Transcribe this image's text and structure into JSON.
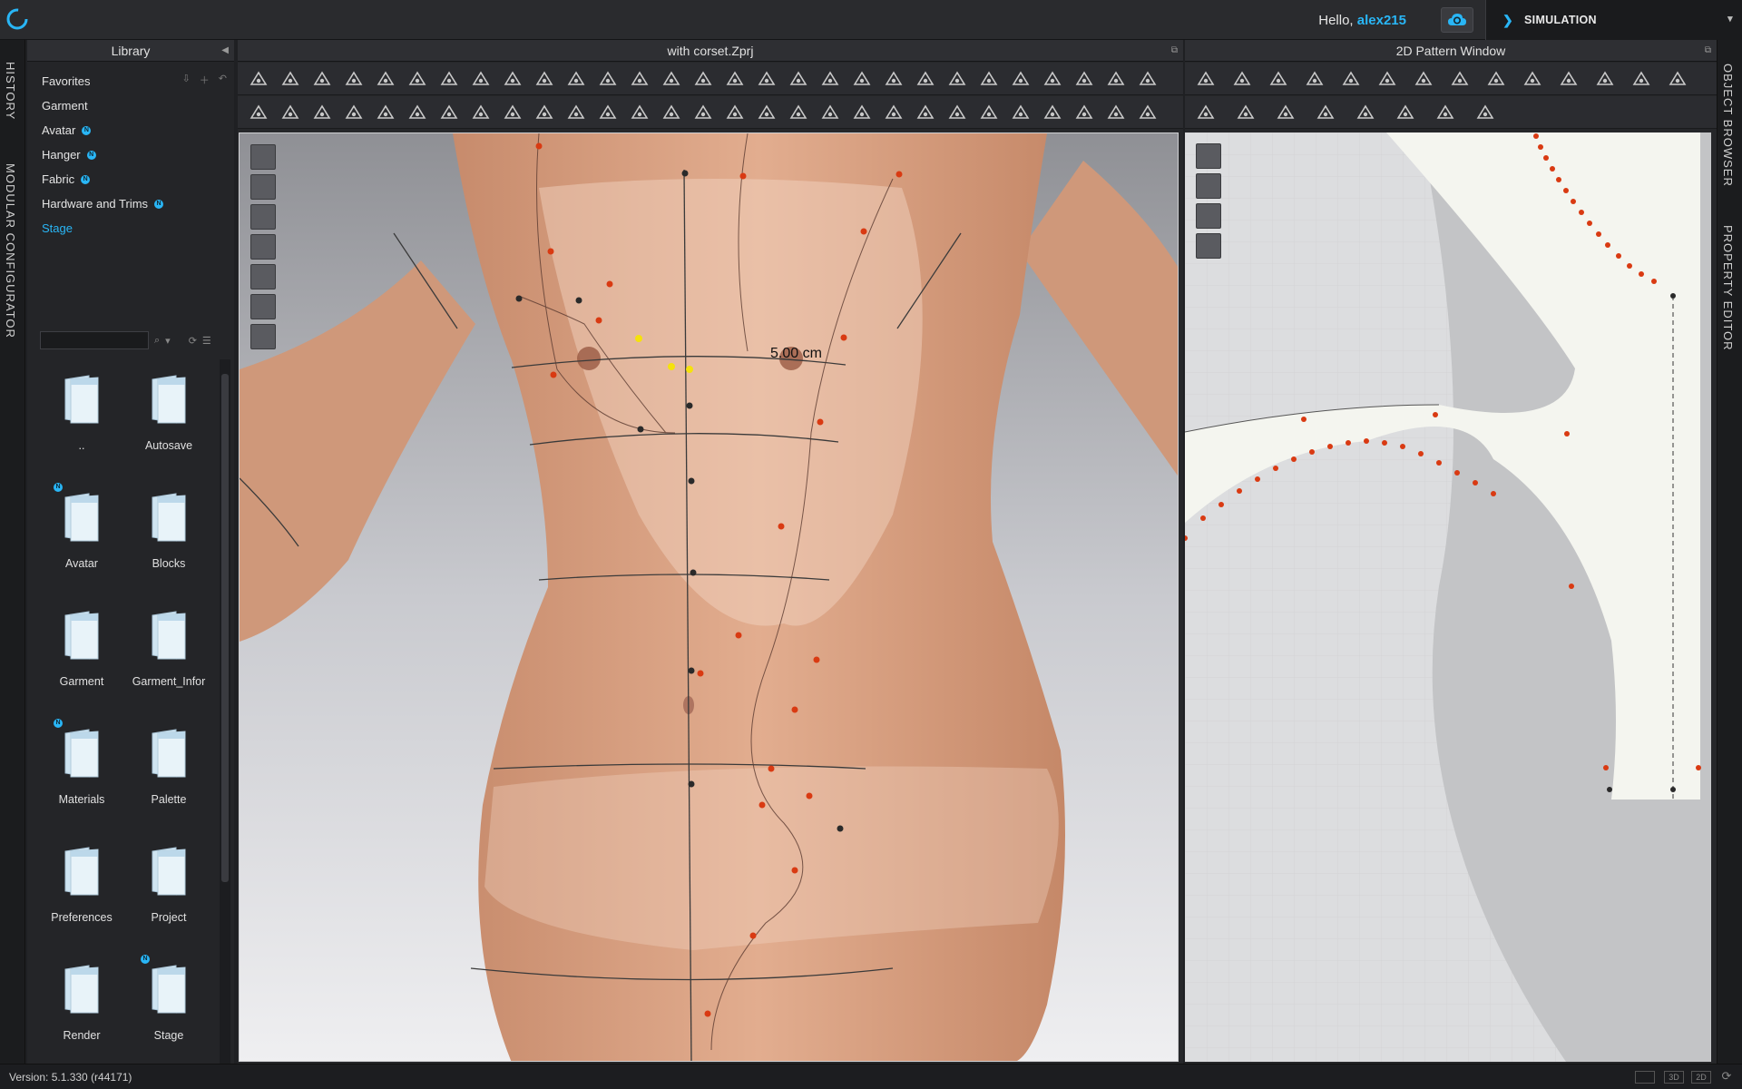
{
  "header": {
    "greeting": "Hello, ",
    "username": "alex215",
    "mode_label": "SIMULATION",
    "accent": "#29b6f6"
  },
  "left_tabs": [
    "HISTORY",
    "MODULAR CONFIGURATOR"
  ],
  "right_tabs": [
    "OBJECT BROWSER",
    "PROPERTY EDITOR"
  ],
  "library": {
    "title": "Library",
    "items": [
      {
        "label": "Favorites",
        "badge": false
      },
      {
        "label": "Garment",
        "badge": false
      },
      {
        "label": "Avatar",
        "badge": true
      },
      {
        "label": "Hanger",
        "badge": true
      },
      {
        "label": "Fabric",
        "badge": true
      },
      {
        "label": "Hardware and Trims",
        "badge": true
      },
      {
        "label": "Stage",
        "badge": false,
        "active": true
      }
    ],
    "search_value": "",
    "folders": [
      {
        "label": "..",
        "badge": false
      },
      {
        "label": "Autosave",
        "badge": false
      },
      {
        "label": "Avatar",
        "badge": true
      },
      {
        "label": "Blocks",
        "badge": false
      },
      {
        "label": "Garment",
        "badge": false
      },
      {
        "label": "Garment_Infor",
        "badge": false
      },
      {
        "label": "Materials",
        "badge": true
      },
      {
        "label": "Palette",
        "badge": false
      },
      {
        "label": "Preferences",
        "badge": false
      },
      {
        "label": "Project",
        "badge": false
      },
      {
        "label": "Render",
        "badge": false
      },
      {
        "label": "Stage",
        "badge": true
      }
    ],
    "badge_glyph": "N"
  },
  "view3d": {
    "title": "with corset.Zprj",
    "measurement": "5.00 cm"
  },
  "view2d": {
    "title": "2D Pattern Window"
  },
  "status": {
    "version": "Version: 5.1.330 (r44171)",
    "view_modes": [
      "",
      "3D",
      "2D"
    ]
  }
}
